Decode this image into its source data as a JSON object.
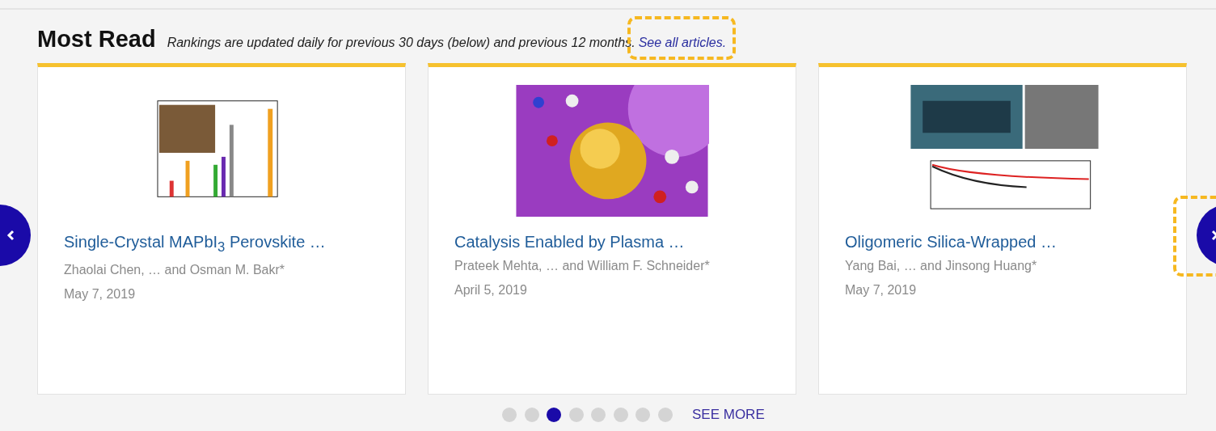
{
  "section": {
    "title": "Most Read",
    "note": "Rankings are updated daily for previous 30 days (below) and previous 12 months.",
    "link": "See all articles."
  },
  "articles": [
    {
      "title": "Single-Crystal MAPbI$_{3}$ Perovskite …",
      "authors": "Zhaolai Chen, … and Osman M. Bakr*",
      "date": "May 7, 2019"
    },
    {
      "title": "Catalysis Enabled by Plasma …",
      "authors": "Prateek Mehta, … and William F. Schneider*",
      "date": "April 5, 2019"
    },
    {
      "title": "Oligomeric Silica-Wrapped …",
      "authors": "Yang Bai, … and Jinsong Huang*",
      "date": "May 7, 2019"
    }
  ],
  "pager": {
    "dots": [
      {
        "selected": false
      },
      {
        "selected": false
      },
      {
        "selected": true
      },
      {
        "selected": false
      },
      {
        "selected": false
      },
      {
        "selected": false
      },
      {
        "selected": false
      },
      {
        "selected": false
      }
    ],
    "more": "SEE MORE"
  }
}
